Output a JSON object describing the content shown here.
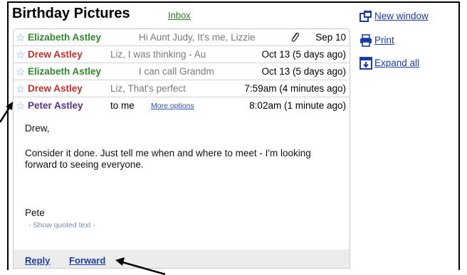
{
  "header": {
    "title": "Birthday Pictures",
    "label": "Inbox"
  },
  "messages": [
    {
      "sender": "Elizabeth Astley",
      "snippet": "Hi Aunt Judy, It's me, Lizzie",
      "date": "Sep 10",
      "color": "#2e8b2e"
    },
    {
      "sender": "Drew Astley",
      "snippet": "Liz, I was thinking - Au",
      "date": "Oct 13 (5 days ago)",
      "color": "#c0302a"
    },
    {
      "sender": "Elizabeth Astley",
      "snippet": "I can call Grandm",
      "date": "Oct 13 (5 days ago)",
      "color": "#2e8b2e"
    },
    {
      "sender": "Drew Astley",
      "snippet": "Liz, That's perfect",
      "date": "7:59am (4 minutes ago)",
      "color": "#c0302a"
    }
  ],
  "open_message": {
    "sender": "Peter Astley",
    "to": "to me",
    "more_options": "More options",
    "date": "8:02am (1 minute ago)",
    "greeting": "Drew,",
    "body_lines": [
      "Consider it done. Just tell me when and where to meet - I'm looking",
      "forward to seeing everyone."
    ],
    "signature": "Pete",
    "quoted_toggle": "- Show quoted text -",
    "color": "#5b2f8c"
  },
  "actions": {
    "reply": "Reply",
    "forward": "Forward"
  },
  "sidebar": {
    "new_window": "New window",
    "print": "Print",
    "expand_all": "Expand all"
  },
  "icons": {
    "star": "star-icon",
    "clip": "paperclip-icon",
    "new_window": "new-window-icon",
    "print": "printer-icon",
    "expand": "expand-all-icon"
  }
}
